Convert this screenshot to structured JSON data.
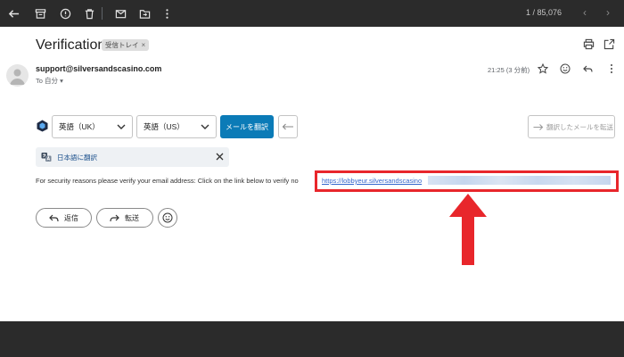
{
  "toolbar": {
    "page_count": "1 / 85,076",
    "prev_icon": "chevron-left-icon",
    "next_icon": "chevron-right-icon"
  },
  "email": {
    "subject": "Verification",
    "label": "受信トレイ",
    "label_close": "×",
    "sender": "support@silversandscasino.com",
    "to": "To 自分 ▾",
    "time": "21:25 (3 分前)"
  },
  "translate": {
    "source_lang": "英語（UK）",
    "target_lang": "英語（US）",
    "translate_button": "メールを翻訳",
    "forward_translated": "翻訳したメールを転送",
    "banner_text": "日本語に翻訳"
  },
  "body": {
    "text": "For security reasons please verify your email address: Click on the link below to verify no",
    "link": "https://lobbyeur.silversandscasino"
  },
  "actions": {
    "reply": "返信",
    "forward": "転送"
  },
  "colors": {
    "accent": "#0b7bb7",
    "highlight": "#e8262b"
  }
}
